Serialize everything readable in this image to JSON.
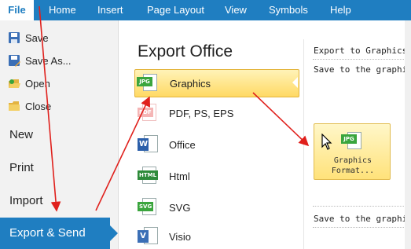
{
  "menubar": {
    "items": [
      {
        "label": "File"
      },
      {
        "label": "Home"
      },
      {
        "label": "Insert"
      },
      {
        "label": "Page Layout"
      },
      {
        "label": "View"
      },
      {
        "label": "Symbols"
      },
      {
        "label": "Help"
      }
    ]
  },
  "sidebar": {
    "small_items": [
      {
        "label": "Save",
        "icon": "save-icon"
      },
      {
        "label": "Save As...",
        "icon": "save-as-icon"
      },
      {
        "label": "Open",
        "icon": "open-icon"
      },
      {
        "label": "Close",
        "icon": "close-folder-icon"
      }
    ],
    "big_items": [
      {
        "label": "New"
      },
      {
        "label": "Print"
      },
      {
        "label": "Import"
      },
      {
        "label": "Export & Send"
      }
    ]
  },
  "export": {
    "title": "Export Office",
    "items": [
      {
        "label": "Graphics",
        "icon": "jpg-file-icon",
        "selected": true
      },
      {
        "label": "PDF, PS, EPS",
        "icon": "pdf-file-icon"
      },
      {
        "label": "Office",
        "icon": "word-file-icon"
      },
      {
        "label": "Html",
        "icon": "html-file-icon"
      },
      {
        "label": "SVG",
        "icon": "svg-file-icon"
      },
      {
        "label": "Visio",
        "icon": "visio-file-icon"
      }
    ]
  },
  "detail": {
    "heading": "Export to Graphics",
    "line1": "Save to the graphics",
    "button_label": "Graphics\nFormat...",
    "line2": "Save to the graphics"
  },
  "colors": {
    "ribbon": "#1f7ec1",
    "selection": "#ffd964",
    "annotation_arrow": "#e0201c"
  }
}
